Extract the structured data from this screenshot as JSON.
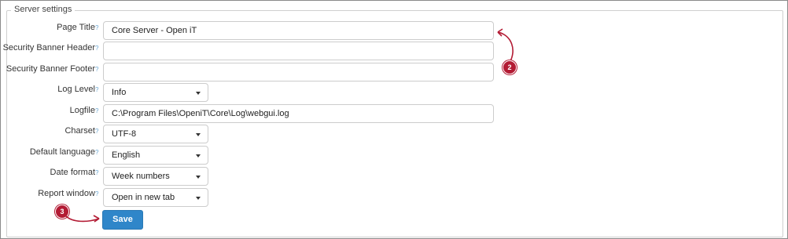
{
  "section": {
    "legend": "Server settings"
  },
  "help_marker": "?",
  "fields": {
    "page_title": {
      "label": "Page Title",
      "value": "Core Server - Open iT"
    },
    "security_banner_header": {
      "label": "Security Banner Header",
      "value": ""
    },
    "security_banner_footer": {
      "label": "Security Banner Footer",
      "value": ""
    },
    "log_level": {
      "label": "Log Level",
      "value": "Info"
    },
    "logfile": {
      "label": "Logfile",
      "value": "C:\\Program Files\\OpeniT\\Core\\Log\\webgui.log"
    },
    "charset": {
      "label": "Charset",
      "value": "UTF-8"
    },
    "default_language": {
      "label": "Default language",
      "value": "English"
    },
    "date_format": {
      "label": "Date format",
      "value": "Week numbers"
    },
    "report_window": {
      "label": "Report window",
      "value": "Open in new tab"
    }
  },
  "actions": {
    "save_label": "Save"
  },
  "callouts": {
    "two": "2",
    "three": "3"
  },
  "colors": {
    "accent": "#2f86c9",
    "callout": "#b31b34"
  }
}
